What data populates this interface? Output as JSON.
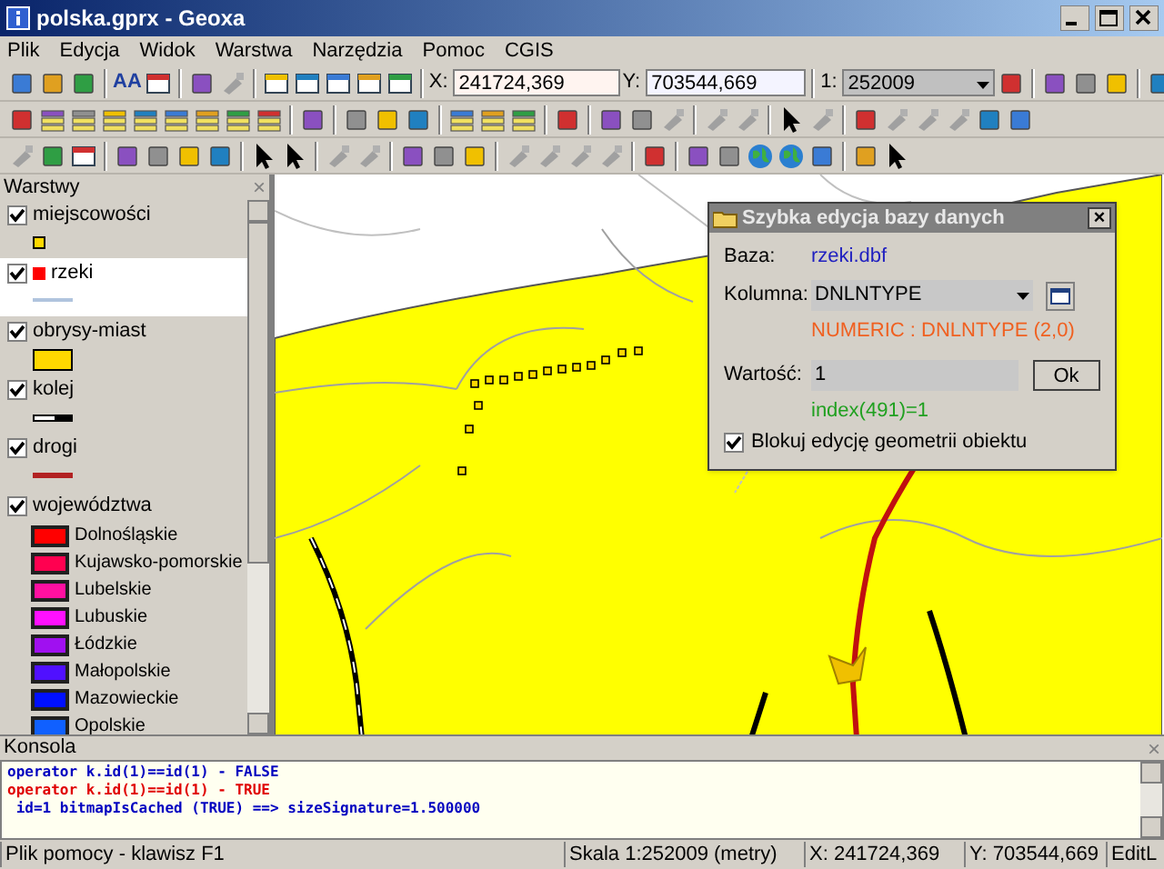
{
  "window": {
    "title": "polska.gprx - Geoxa"
  },
  "menu": [
    "Plik",
    "Edycja",
    "Widok",
    "Warstwa",
    "Narzędzia",
    "Pomoc",
    "CGIS"
  ],
  "toolbar": {
    "font_button": "AA",
    "x_label": "X:",
    "x_value": "241724,369",
    "y_label": "Y:",
    "y_value": "703544,669",
    "scale_label": "1:",
    "scale_value": "252009"
  },
  "layers_panel": {
    "title": "Warstwy",
    "close": "×",
    "layers": [
      {
        "name": "miejscowości",
        "checked": true,
        "selected": false,
        "kind": "point",
        "color": "#ffd800"
      },
      {
        "name": "rzeki",
        "checked": true,
        "selected": true,
        "kind": "line",
        "color": "#b0c4de"
      },
      {
        "name": "obrysy-miast",
        "checked": true,
        "selected": false,
        "kind": "polygon",
        "color": "#ffd800"
      },
      {
        "name": "kolej",
        "checked": true,
        "selected": false,
        "kind": "rail",
        "color": "#000000"
      },
      {
        "name": "drogi",
        "checked": true,
        "selected": false,
        "kind": "line",
        "color": "#b22222"
      },
      {
        "name": "województwa",
        "checked": true,
        "selected": false,
        "kind": "categories",
        "categories": [
          {
            "label": "Dolnośląskie",
            "color": "#ff0000"
          },
          {
            "label": "Kujawsko-pomorskie",
            "color": "#ff0050"
          },
          {
            "label": "Lubelskie",
            "color": "#ff10a0"
          },
          {
            "label": "Lubuskie",
            "color": "#ff10ff"
          },
          {
            "label": "Łódzkie",
            "color": "#a010f0"
          },
          {
            "label": "Małopolskie",
            "color": "#5010ff"
          },
          {
            "label": "Mazowieckie",
            "color": "#0010ff"
          },
          {
            "label": "Opolskie",
            "color": "#1060ff"
          }
        ]
      }
    ]
  },
  "dialog": {
    "title": "Szybka edycja bazy danych",
    "close": "×",
    "base_label": "Baza:",
    "base_value": "rzeki.dbf",
    "column_label": "Kolumna:",
    "column_value": "DNLNTYPE",
    "column_type": "NUMERIC : DNLNTYPE (2,0)",
    "value_label": "Wartość:",
    "value": "1",
    "ok": "Ok",
    "index_info": "index(491)=1",
    "lock_label": "Blokuj edycję geometrii obiektu",
    "lock_checked": true
  },
  "console": {
    "title": "Konsola",
    "close": "×",
    "lines": [
      {
        "text": "operator k.id(1)==id(1) - FALSE",
        "color": "#0000c0"
      },
      {
        "text": "operator k.id(1)==id(1) - TRUE",
        "color": "#e00000"
      },
      {
        "text": " id=1 bitmapIsCached (TRUE) ==> sizeSignature=1.500000",
        "color": "#0000c0"
      }
    ]
  },
  "status_bar": [
    "Plik pomocy - klawisz F1",
    "Skala 1:252009 (metry)",
    "X: 241724,369",
    "Y: 703544,669",
    "EditL"
  ]
}
